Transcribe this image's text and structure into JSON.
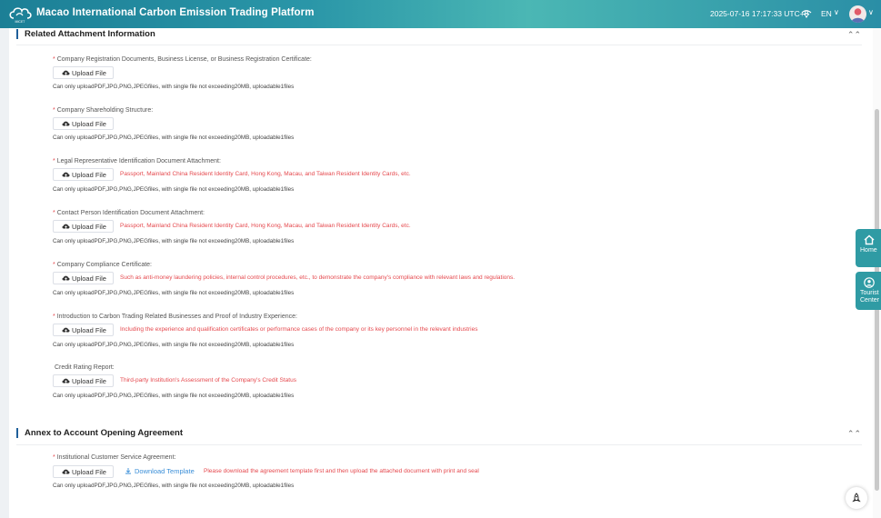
{
  "header": {
    "title": "Macao International Carbon Emission Trading Platform",
    "datetime": "2025-07-16 17:17:33 UTC+8",
    "language": "EN",
    "lang_caret": "∨",
    "avatar_caret": "∨",
    "logo_icon": "cloud-logo-icon",
    "wifi_icon": "wifi-icon"
  },
  "sections": [
    {
      "title": "Related Attachment Information",
      "collapse_glyph": "⌃⌃"
    },
    {
      "title": "Annex to Account Opening Agreement",
      "collapse_glyph": "⌃⌃"
    }
  ],
  "upload_label": "Upload File",
  "file_note": "Can only uploadPDF,JPG,PNG,JPEGfiles, with single file not exceeding20MB, uploadable1files",
  "attachments": [
    {
      "required": "*",
      "label": "Company Registration Documents, Business License, or Business Registration Certificate:",
      "hint": ""
    },
    {
      "required": "*",
      "label": "Company Shareholding Structure:",
      "hint": ""
    },
    {
      "required": "*",
      "label": "Legal Representative Identification Document Attachment:",
      "hint": "Passport, Mainland China Resident Identity Card, Hong Kong, Macau, and Taiwan Resident Identity Cards, etc."
    },
    {
      "required": "*",
      "label": "Contact Person Identification Document Attachment:",
      "hint": "Passport, Mainland China Resident Identity Card, Hong Kong, Macau, and Taiwan Resident Identity Cards, etc."
    },
    {
      "required": "*",
      "label": "Company Compliance Certificate:",
      "hint": "Such as anti-money laundering policies, internal control procedures, etc., to demonstrate the company's compliance with relevant laws and regulations."
    },
    {
      "required": "*",
      "label": "Introduction to Carbon Trading Related Businesses and Proof of Industry Experience:",
      "hint": "Including the experience and qualification certificates or performance cases of the company or its key personnel in the relevant industries"
    },
    {
      "required": "",
      "label": "Credit Rating Report:",
      "hint": "Third-party Institution's Assessment of the Company's Credit Status"
    }
  ],
  "agreement": {
    "required": "*",
    "label": "Institutional Customer Service Agreement:",
    "download_label": "Download Template",
    "hint": "Please download the agreement template first and then upload the attached document with print and seal"
  },
  "float_buttons": [
    {
      "label": "Home",
      "icon": "home-icon"
    },
    {
      "label": "Tourist Center",
      "icon": "user-icon"
    }
  ],
  "colors": {
    "accent": "#2a96a8",
    "required": "#e5484d",
    "link": "#3b8fd8",
    "section_bar": "#1f5f9a"
  }
}
